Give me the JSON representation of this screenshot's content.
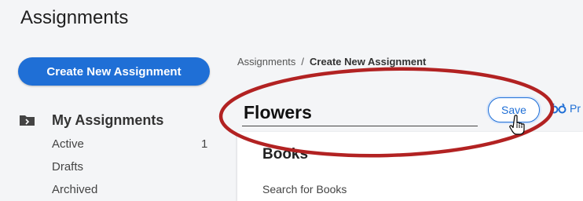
{
  "page": {
    "title": "Assignments"
  },
  "sidebar": {
    "create_label": "Create New Assignment",
    "section_title": "My Assignments",
    "items": [
      {
        "label": "Active",
        "count": "1"
      },
      {
        "label": "Drafts",
        "count": ""
      },
      {
        "label": "Archived",
        "count": ""
      }
    ]
  },
  "breadcrumb": {
    "root": "Assignments",
    "separator": "/",
    "current": "Create New Assignment"
  },
  "editor": {
    "title_value": "Flowers",
    "save_label": "Save",
    "preview_label": "Pr"
  },
  "card": {
    "title": "Books",
    "search_label": "Search for Books"
  },
  "colors": {
    "primary": "#1f6fd6",
    "annotation": "#b22222"
  },
  "icons": [
    "folder-icon",
    "preview-icon",
    "hand-cursor-icon"
  ]
}
